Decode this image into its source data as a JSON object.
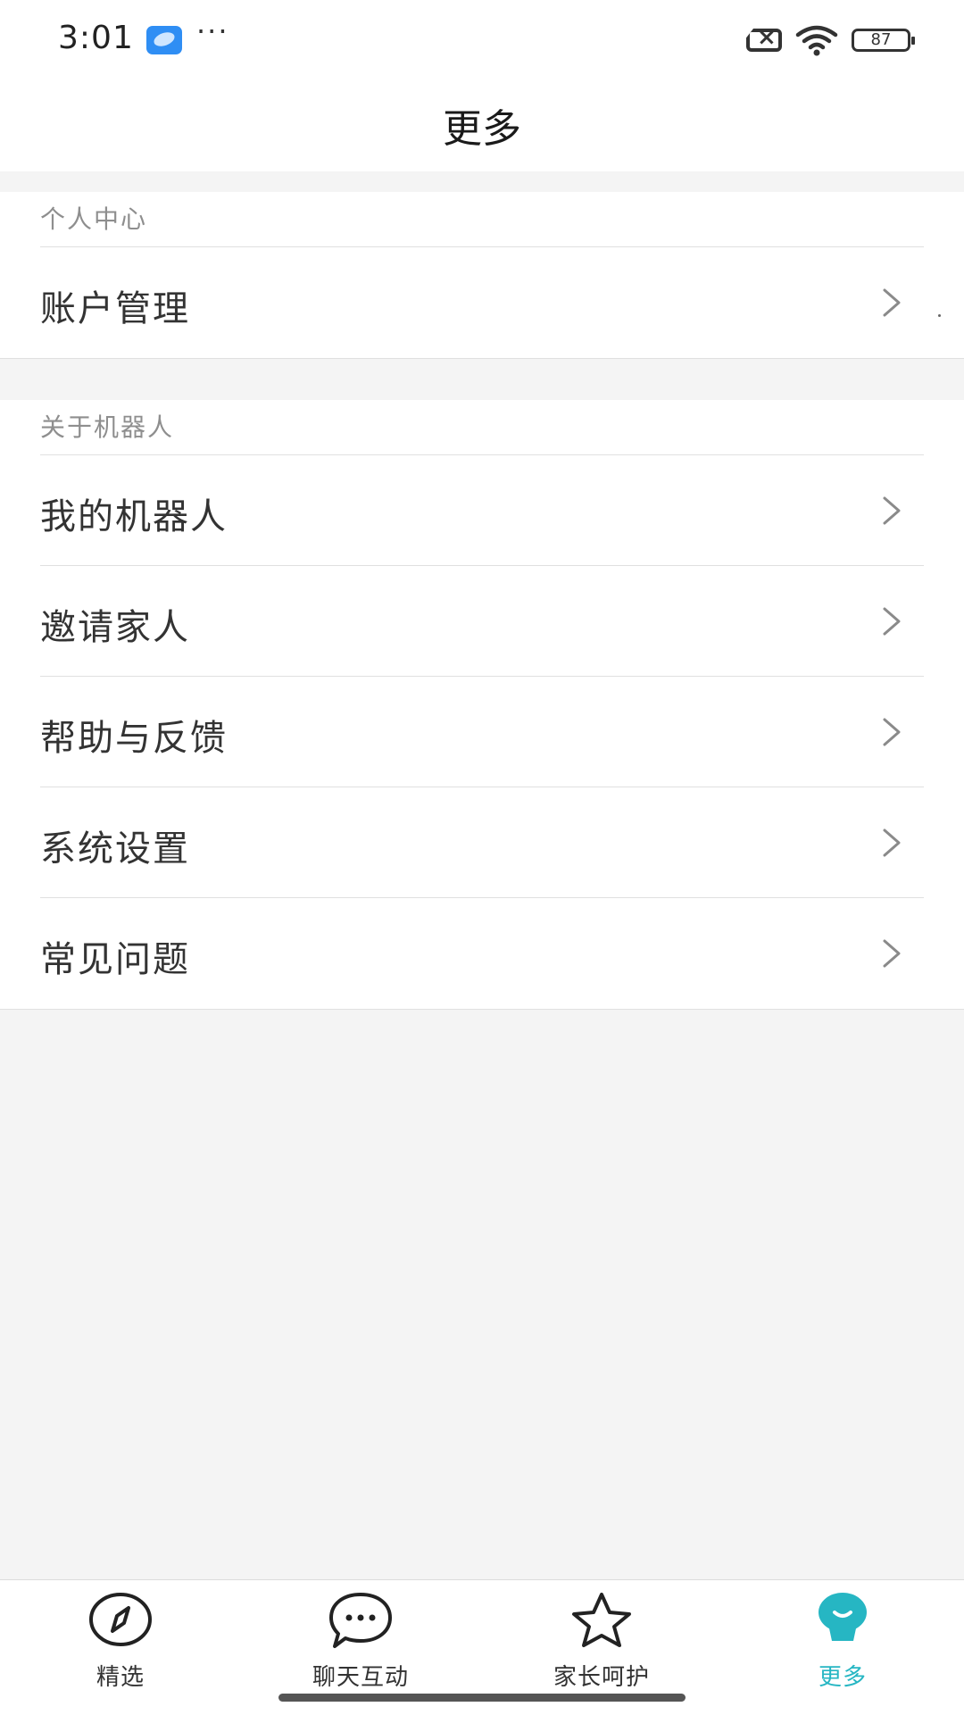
{
  "status_bar": {
    "time": "3:01",
    "more": "···",
    "battery": "87"
  },
  "header": {
    "title": "更多"
  },
  "sections": [
    {
      "header": "个人中心",
      "items": [
        {
          "label": "账户管理"
        }
      ]
    },
    {
      "header": "关于机器人",
      "items": [
        {
          "label": "我的机器人"
        },
        {
          "label": "邀请家人"
        },
        {
          "label": "帮助与反馈"
        },
        {
          "label": "系统设置"
        },
        {
          "label": "常见问题"
        }
      ]
    }
  ],
  "bottom_nav": {
    "items": [
      {
        "label": "精选",
        "icon": "compass-icon"
      },
      {
        "label": "聊天互动",
        "icon": "chat-bubble-icon"
      },
      {
        "label": "家长呵护",
        "icon": "star-icon"
      },
      {
        "label": "更多",
        "icon": "robot-icon"
      }
    ],
    "active_index": 3,
    "active_color": "#26b6c3"
  }
}
